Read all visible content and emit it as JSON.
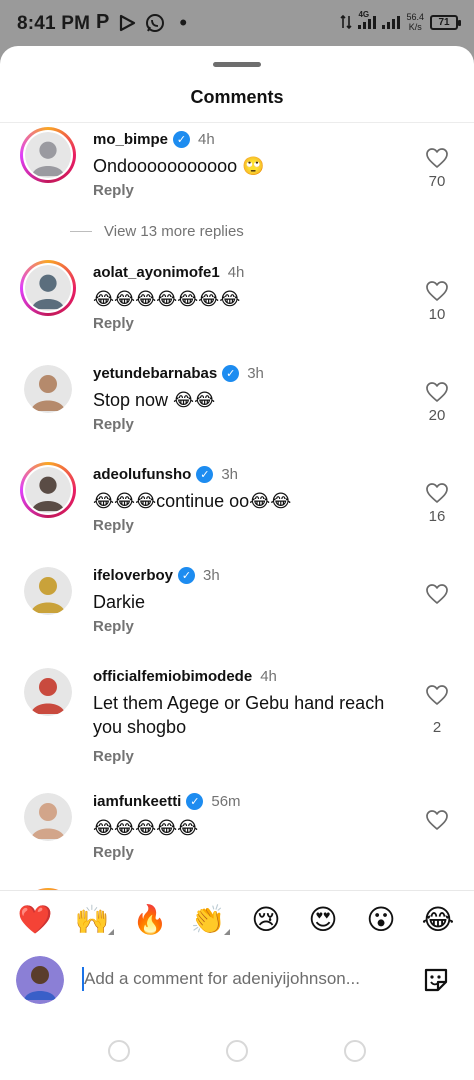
{
  "status_bar": {
    "time": "8:41 PM",
    "app_icons": [
      "p-icon",
      "play-icon",
      "whatsapp-icon"
    ],
    "dot": "•",
    "network": "4G",
    "speed_value": "56.4",
    "speed_unit": "K/s",
    "battery": "71"
  },
  "sheet": {
    "title": "Comments"
  },
  "comments": [
    {
      "username": "mo_bimpe",
      "verified": true,
      "time": "4h",
      "text": "Ondooooooooooo 🙄",
      "reply": "Reply",
      "likes": "70",
      "story_ring": true,
      "avatar_color": "#9a9aa0"
    },
    {
      "username": "aolat_ayonimofe1",
      "verified": false,
      "time": "4h",
      "text": "😂😂😂😂😂😂😂",
      "reply": "Reply",
      "likes": "10",
      "story_ring": true,
      "avatar_color": "#5b6e7d"
    },
    {
      "username": "yetundebarnabas",
      "verified": true,
      "time": "3h",
      "text": "Stop now 😂😂",
      "reply": "Reply",
      "likes": "20",
      "story_ring": false,
      "avatar_color": "#b58a6c"
    },
    {
      "username": "adeolufunsho",
      "verified": true,
      "time": "3h",
      "text": "😂😂😂continue oo😂😂",
      "reply": "Reply",
      "likes": "16",
      "story_ring": true,
      "avatar_color": "#5a4c45"
    },
    {
      "username": "ifeloverboy",
      "verified": true,
      "time": "3h",
      "text": "Darkie",
      "reply": "Reply",
      "likes": "",
      "story_ring": false,
      "avatar_color": "#c9a23a"
    },
    {
      "username": "officialfemiobimodede",
      "verified": false,
      "time": "4h",
      "text": "Let them Agege or Gebu hand reach you shogbo",
      "reply": "Reply",
      "likes": "2",
      "story_ring": false,
      "avatar_color": "#c94a3e"
    },
    {
      "username": "iamfunkeetti",
      "verified": true,
      "time": "56m",
      "text": "😂😂😂😂😂",
      "reply": "Reply",
      "likes": "",
      "story_ring": false,
      "avatar_color": "#d2a58a"
    }
  ],
  "view_more_replies": "View 13 more replies",
  "emoji_bar": [
    "❤️",
    "🙌",
    "🔥",
    "👏",
    "😢",
    "😍",
    "😮",
    "😂"
  ],
  "compose": {
    "placeholder": "Add a comment for adeniyijohnson...",
    "avatar_color": "#6a5acd"
  },
  "colors": {
    "accent_blue": "#1d8cf0",
    "secondary_text": "#737373",
    "status_bar_bg": "#9a9a9a"
  }
}
